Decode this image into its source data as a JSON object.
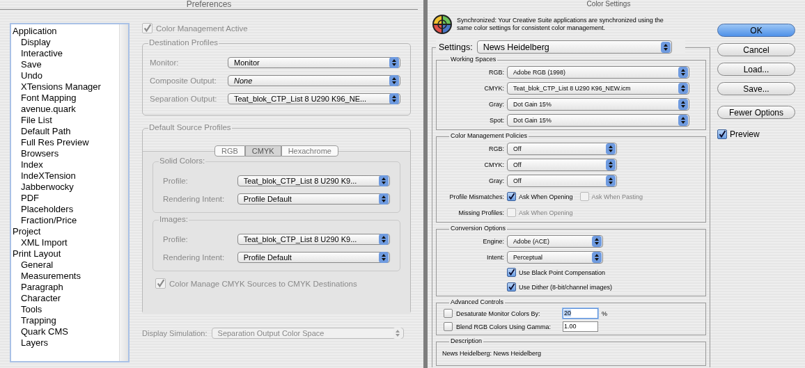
{
  "preferences": {
    "title": "Preferences",
    "tree": [
      {
        "label": "Application",
        "children": [
          {
            "label": "Display"
          },
          {
            "label": "Interactive"
          },
          {
            "label": "Save"
          },
          {
            "label": "Undo"
          },
          {
            "label": "XTensions Manager"
          },
          {
            "label": "Font Mapping"
          },
          {
            "label": "avenue.quark"
          },
          {
            "label": "File List"
          },
          {
            "label": "Default Path"
          },
          {
            "label": "Full Res Preview"
          },
          {
            "label": "Browsers"
          },
          {
            "label": "Index"
          },
          {
            "label": "IndeXTension"
          },
          {
            "label": "Jabberwocky"
          },
          {
            "label": "PDF"
          },
          {
            "label": "Placeholders"
          },
          {
            "label": "Fraction/Price"
          }
        ]
      },
      {
        "label": "Project",
        "children": [
          {
            "label": "XML Import"
          }
        ]
      },
      {
        "label": "Print Layout",
        "children": [
          {
            "label": "General"
          },
          {
            "label": "Measurements"
          },
          {
            "label": "Paragraph"
          },
          {
            "label": "Character"
          },
          {
            "label": "Tools"
          },
          {
            "label": "Trapping"
          },
          {
            "label": "Quark CMS"
          },
          {
            "label": "Layers"
          }
        ]
      }
    ],
    "color_management_active": {
      "label": "Color Management Active",
      "checked": true,
      "disabled": true
    },
    "destination_profiles": {
      "title": "Destination Profiles",
      "fields": [
        {
          "label": "Monitor:",
          "value": "Monitor",
          "italic": false
        },
        {
          "label": "Composite Output:",
          "value": "None",
          "italic": true
        },
        {
          "label": "Separation Output:",
          "value": "Teat_blok_CTP_List 8 U290 K96_NE...",
          "italic": false
        }
      ]
    },
    "default_source_profiles": {
      "title": "Default Source Profiles",
      "tabs": [
        {
          "label": "RGB",
          "selected": false
        },
        {
          "label": "CMYK",
          "selected": true
        },
        {
          "label": "Hexachrome",
          "selected": false
        }
      ],
      "groups": [
        {
          "title": "Solid Colors:",
          "fields": [
            {
              "label": "Profile:",
              "value": "Teat_blok_CTP_List 8 U290 K9..."
            },
            {
              "label": "Rendering Intent:",
              "value": "Profile Default"
            }
          ]
        },
        {
          "title": "Images:",
          "fields": [
            {
              "label": "Profile:",
              "value": "Teat_blok_CTP_List 8 U290 K9..."
            },
            {
              "label": "Rendering Intent:",
              "value": "Profile Default"
            }
          ]
        }
      ],
      "cmyk_to_cmyk": {
        "label": "Color Manage CMYK Sources to CMYK Destinations",
        "checked": true,
        "disabled": true
      }
    },
    "display_simulation": {
      "label": "Display Simulation:",
      "value": "Separation Output Color Space",
      "disabled": true
    }
  },
  "color_settings": {
    "title": "Color Settings",
    "message": "Synchronized: Your Creative Suite applications are synchronized using the same color settings for consistent color management.",
    "settings": {
      "label": "Settings:",
      "value": "News Heidelberg"
    },
    "sections": [
      {
        "title": "Working Spaces",
        "rows": [
          {
            "kind": "popup",
            "label": "RGB:",
            "value": "Adobe RGB (1998)"
          },
          {
            "kind": "popup",
            "label": "CMYK:",
            "value": "Teat_blok_CTP_List 8 U290 K96_NEW.icm"
          },
          {
            "kind": "popup",
            "label": "Gray:",
            "value": "Dot Gain 15%"
          },
          {
            "kind": "popup",
            "label": "Spot:",
            "value": "Dot Gain 15%"
          }
        ]
      },
      {
        "title": "Color Management Policies",
        "rows": [
          {
            "kind": "popup",
            "label": "RGB:",
            "value": "Off"
          },
          {
            "kind": "popup",
            "label": "CMYK:",
            "value": "Off"
          },
          {
            "kind": "popup",
            "label": "Gray:",
            "value": "Off"
          },
          {
            "kind": "checks",
            "label": "Profile Mismatches:",
            "options": [
              {
                "label": "Ask When Opening",
                "checked": true,
                "disabled": false
              },
              {
                "label": "Ask When Pasting",
                "checked": false,
                "disabled": true
              }
            ]
          },
          {
            "kind": "checks",
            "label": "Missing Profiles:",
            "options": [
              {
                "label": "Ask When Opening",
                "checked": false,
                "disabled": true
              }
            ]
          }
        ]
      },
      {
        "title": "Conversion Options",
        "rows": [
          {
            "kind": "popup",
            "label": "Engine:",
            "value": "Adobe (ACE)"
          },
          {
            "kind": "popup",
            "label": "Intent:",
            "value": "Perceptual"
          },
          {
            "kind": "checks",
            "options": [
              {
                "label": "Use Black Point Compensation",
                "checked": true,
                "disabled": false
              }
            ]
          },
          {
            "kind": "checks",
            "options": [
              {
                "label": "Use Dither (8-bit/channel images)",
                "checked": true,
                "disabled": false
              }
            ]
          }
        ]
      },
      {
        "title": "Advanced Controls",
        "rows": [
          {
            "kind": "entry",
            "label": "Desaturate Monitor Colors By:",
            "checked": false,
            "value": "20",
            "highlighted": true,
            "unit": "%"
          },
          {
            "kind": "entry",
            "label": "Blend RGB Colors Using Gamma:",
            "checked": false,
            "value": "1.00",
            "highlighted": false
          }
        ]
      },
      {
        "title": "Description",
        "rows": [
          {
            "kind": "text",
            "value": "News Heidelberg:  News Heidelberg"
          }
        ]
      }
    ],
    "buttons": [
      {
        "label": "OK",
        "default": true
      },
      {
        "label": "Cancel",
        "default": false
      },
      {
        "label": "Load...",
        "default": false
      },
      {
        "label": "Save...",
        "default": false
      },
      {
        "label": "Fewer Options",
        "default": false
      }
    ],
    "preview": {
      "label": "Preview",
      "checked": true
    }
  }
}
